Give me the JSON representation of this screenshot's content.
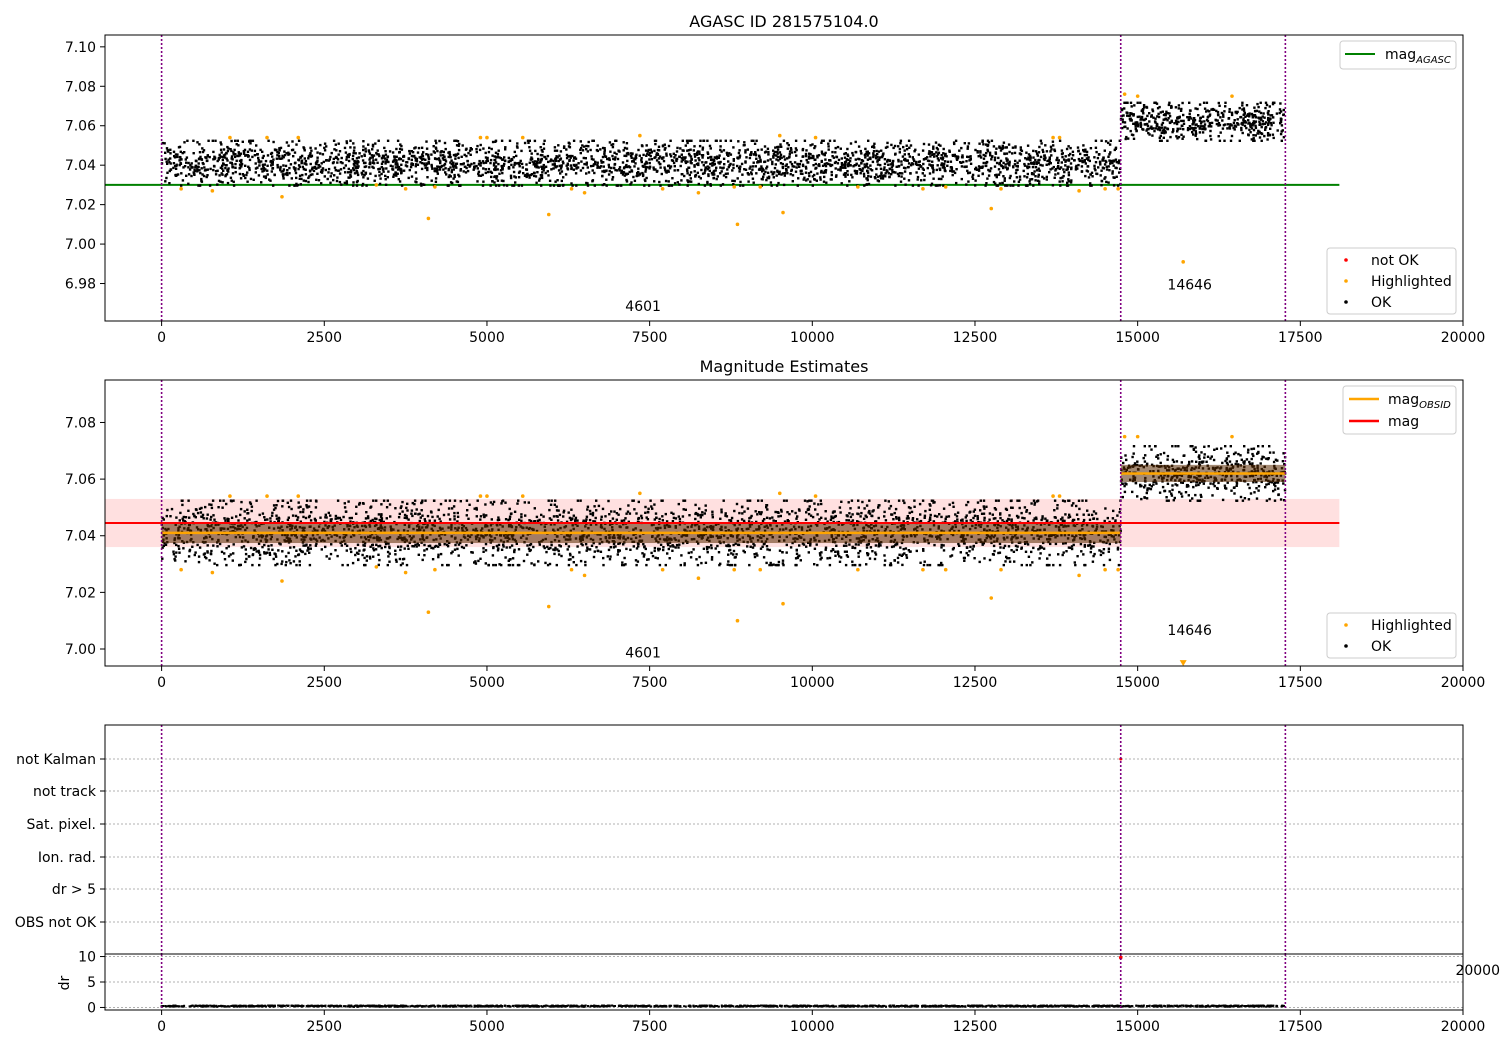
{
  "chart_data": [
    {
      "type": "scatter",
      "title": "AGASC ID 281575104.0",
      "xlim": [
        -870,
        20000
      ],
      "ylim": [
        6.961,
        7.106
      ],
      "xticks": [
        "0",
        "2500",
        "5000",
        "7500",
        "10000",
        "12500",
        "15000",
        "17500",
        "20000"
      ],
      "xtick_values": [
        0,
        2500,
        5000,
        7500,
        10000,
        12500,
        15000,
        17500,
        20000
      ],
      "yticks": [
        "6.98",
        "7.00",
        "7.02",
        "7.04",
        "7.06",
        "7.08",
        "7.10"
      ],
      "ytick_values": [
        6.98,
        7.0,
        7.02,
        7.04,
        7.06,
        7.08,
        7.1
      ],
      "vlines": [
        0,
        14740,
        17270
      ],
      "hline": {
        "name": "mag",
        "subscript": "AGASC",
        "y": 7.03,
        "x": [
          -870,
          18100
        ],
        "color": "#008000"
      },
      "bands": [
        {
          "x": [
            0,
            14740
          ],
          "center": 7.041,
          "spread": 0.0065
        },
        {
          "x": [
            14740,
            17270
          ],
          "center": 7.062,
          "spread": 0.0055
        }
      ],
      "highlighted": [
        [
          300,
          7.028
        ],
        [
          780,
          7.027
        ],
        [
          1050,
          7.054
        ],
        [
          1620,
          7.054
        ],
        [
          1850,
          7.024
        ],
        [
          2100,
          7.054
        ],
        [
          3300,
          7.03
        ],
        [
          3750,
          7.028
        ],
        [
          4100,
          7.013
        ],
        [
          4200,
          7.029
        ],
        [
          4900,
          7.054
        ],
        [
          5000,
          7.054
        ],
        [
          5550,
          7.054
        ],
        [
          5950,
          7.015
        ],
        [
          6300,
          7.028
        ],
        [
          6500,
          7.026
        ],
        [
          7350,
          7.055
        ],
        [
          7700,
          7.028
        ],
        [
          8250,
          7.026
        ],
        [
          8800,
          7.029
        ],
        [
          8850,
          7.01
        ],
        [
          9200,
          7.029
        ],
        [
          9500,
          7.055
        ],
        [
          9550,
          7.016
        ],
        [
          10050,
          7.054
        ],
        [
          10700,
          7.029
        ],
        [
          11700,
          7.028
        ],
        [
          12050,
          7.029
        ],
        [
          12750,
          7.018
        ],
        [
          12900,
          7.028
        ],
        [
          13700,
          7.054
        ],
        [
          13800,
          7.054
        ],
        [
          14100,
          7.027
        ],
        [
          14500,
          7.028
        ],
        [
          14700,
          7.028
        ],
        [
          14800,
          7.076
        ],
        [
          15000,
          7.075
        ],
        [
          15700,
          6.991
        ],
        [
          16450,
          7.075
        ]
      ],
      "annotations": [
        {
          "text": "4601",
          "x": 7400,
          "y": 6.966
        },
        {
          "text": "14646",
          "x": 15800,
          "y": 6.977
        }
      ],
      "legend_lines": [
        {
          "label": "mag",
          "subscript": "AGASC",
          "color": "#008000"
        }
      ],
      "legend_points": [
        {
          "label": "not OK",
          "color": "#ff0000"
        },
        {
          "label": "Highlighted",
          "color": "#ffa500"
        },
        {
          "label": "OK",
          "color": "#000000"
        }
      ]
    },
    {
      "type": "scatter",
      "title": "Magnitude Estimates",
      "xlim": [
        -870,
        20000
      ],
      "ylim": [
        6.994,
        7.095
      ],
      "xticks": [
        "0",
        "2500",
        "5000",
        "7500",
        "10000",
        "12500",
        "15000",
        "17500",
        "20000"
      ],
      "xtick_values": [
        0,
        2500,
        5000,
        7500,
        10000,
        12500,
        15000,
        17500,
        20000
      ],
      "yticks": [
        "7.00",
        "7.02",
        "7.04",
        "7.06",
        "7.08"
      ],
      "ytick_values": [
        7.0,
        7.02,
        7.04,
        7.06,
        7.08
      ],
      "vlines": [
        0,
        14740,
        17270
      ],
      "mag": {
        "name": "mag",
        "y": 7.0445,
        "band": [
          7.036,
          7.053
        ],
        "x": [
          -870,
          18100
        ],
        "color": "#ff0000"
      },
      "mag_obsid": [
        {
          "name": "mag",
          "subscript": "OBSID",
          "y": 7.041,
          "x": [
            0,
            14740
          ],
          "color": "#ffa500"
        },
        {
          "name": "mag",
          "subscript": "OBSID",
          "y": 7.062,
          "x": [
            14740,
            17270
          ],
          "color": "#ffa500"
        }
      ],
      "bands": [
        {
          "x": [
            0,
            14740
          ],
          "center": 7.041,
          "spread": 0.0065
        },
        {
          "x": [
            14740,
            17270
          ],
          "center": 7.062,
          "spread": 0.0055
        }
      ],
      "highlighted": [
        [
          300,
          7.028
        ],
        [
          780,
          7.027
        ],
        [
          1050,
          7.054
        ],
        [
          1620,
          7.054
        ],
        [
          1850,
          7.024
        ],
        [
          2100,
          7.054
        ],
        [
          3300,
          7.029
        ],
        [
          3750,
          7.027
        ],
        [
          4100,
          7.013
        ],
        [
          4200,
          7.028
        ],
        [
          4900,
          7.054
        ],
        [
          5000,
          7.054
        ],
        [
          5550,
          7.054
        ],
        [
          5950,
          7.015
        ],
        [
          6300,
          7.028
        ],
        [
          6500,
          7.026
        ],
        [
          7350,
          7.055
        ],
        [
          7700,
          7.028
        ],
        [
          8250,
          7.025
        ],
        [
          8800,
          7.028
        ],
        [
          8850,
          7.01
        ],
        [
          9200,
          7.028
        ],
        [
          9500,
          7.055
        ],
        [
          9550,
          7.016
        ],
        [
          10050,
          7.054
        ],
        [
          10700,
          7.028
        ],
        [
          11700,
          7.028
        ],
        [
          12050,
          7.028
        ],
        [
          12750,
          7.018
        ],
        [
          12900,
          7.028
        ],
        [
          13700,
          7.054
        ],
        [
          13800,
          7.054
        ],
        [
          14100,
          7.026
        ],
        [
          14500,
          7.028
        ],
        [
          14700,
          7.028
        ],
        [
          14800,
          7.075
        ],
        [
          15000,
          7.075
        ],
        [
          16450,
          7.075
        ]
      ],
      "offscale_marker": {
        "x": 15700,
        "y": 6.995
      },
      "annotations": [
        {
          "text": "4601",
          "x": 7400,
          "y": 6.997
        },
        {
          "text": "14646",
          "x": 15800,
          "y": 7.005
        }
      ],
      "legend_lines": [
        {
          "label": "mag",
          "subscript": "OBSID",
          "color": "#ffa500"
        },
        {
          "label": "mag",
          "subscript": "",
          "color": "#ff0000"
        }
      ],
      "legend_points": [
        {
          "label": "Highlighted",
          "color": "#ffa500"
        },
        {
          "label": "OK",
          "color": "#000000"
        }
      ]
    },
    {
      "type": "scatter",
      "title": "",
      "xlim": [
        -870,
        20000
      ],
      "flag_labels": [
        "not Kalman",
        "not track",
        "Sat. pixel.",
        "Ion. rad.",
        "dr > 5",
        "OBS not OK"
      ],
      "vlines": [
        0,
        14740,
        17270
      ],
      "flag_points": [
        {
          "row": "not Kalman",
          "x": 14740
        }
      ]
    },
    {
      "type": "scatter",
      "title": "",
      "ylabel": "dr",
      "xlim": [
        -870,
        20000
      ],
      "ylim": [
        -0.5,
        10.5
      ],
      "yticks": [
        "0",
        "5",
        "10"
      ],
      "ytick_values": [
        0,
        5,
        10
      ],
      "xticks": [
        "0",
        "2500",
        "5000",
        "7500",
        "10000",
        "12500",
        "15000",
        "17500",
        "20000"
      ],
      "xtick_values": [
        0,
        2500,
        5000,
        7500,
        10000,
        12500,
        15000,
        17500,
        20000
      ],
      "vlines": [
        0,
        14740,
        17270
      ],
      "baseline": {
        "x": [
          0,
          17270
        ],
        "center": 0.15,
        "spread": 0.15
      },
      "outlier": {
        "x": 14740,
        "y": 9.8
      },
      "clipped_tick": "20000"
    }
  ]
}
